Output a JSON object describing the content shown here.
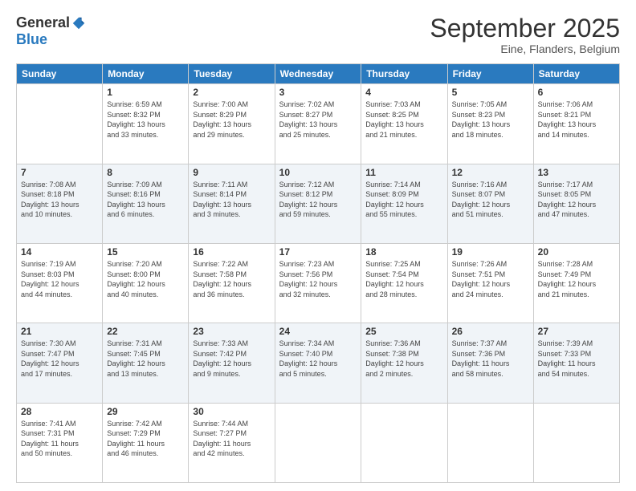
{
  "header": {
    "logo_general": "General",
    "logo_blue": "Blue",
    "month_title": "September 2025",
    "location": "Eine, Flanders, Belgium"
  },
  "days_of_week": [
    "Sunday",
    "Monday",
    "Tuesday",
    "Wednesday",
    "Thursday",
    "Friday",
    "Saturday"
  ],
  "weeks": [
    [
      {
        "day": "",
        "info": ""
      },
      {
        "day": "1",
        "info": "Sunrise: 6:59 AM\nSunset: 8:32 PM\nDaylight: 13 hours\nand 33 minutes."
      },
      {
        "day": "2",
        "info": "Sunrise: 7:00 AM\nSunset: 8:29 PM\nDaylight: 13 hours\nand 29 minutes."
      },
      {
        "day": "3",
        "info": "Sunrise: 7:02 AM\nSunset: 8:27 PM\nDaylight: 13 hours\nand 25 minutes."
      },
      {
        "day": "4",
        "info": "Sunrise: 7:03 AM\nSunset: 8:25 PM\nDaylight: 13 hours\nand 21 minutes."
      },
      {
        "day": "5",
        "info": "Sunrise: 7:05 AM\nSunset: 8:23 PM\nDaylight: 13 hours\nand 18 minutes."
      },
      {
        "day": "6",
        "info": "Sunrise: 7:06 AM\nSunset: 8:21 PM\nDaylight: 13 hours\nand 14 minutes."
      }
    ],
    [
      {
        "day": "7",
        "info": "Sunrise: 7:08 AM\nSunset: 8:18 PM\nDaylight: 13 hours\nand 10 minutes."
      },
      {
        "day": "8",
        "info": "Sunrise: 7:09 AM\nSunset: 8:16 PM\nDaylight: 13 hours\nand 6 minutes."
      },
      {
        "day": "9",
        "info": "Sunrise: 7:11 AM\nSunset: 8:14 PM\nDaylight: 13 hours\nand 3 minutes."
      },
      {
        "day": "10",
        "info": "Sunrise: 7:12 AM\nSunset: 8:12 PM\nDaylight: 12 hours\nand 59 minutes."
      },
      {
        "day": "11",
        "info": "Sunrise: 7:14 AM\nSunset: 8:09 PM\nDaylight: 12 hours\nand 55 minutes."
      },
      {
        "day": "12",
        "info": "Sunrise: 7:16 AM\nSunset: 8:07 PM\nDaylight: 12 hours\nand 51 minutes."
      },
      {
        "day": "13",
        "info": "Sunrise: 7:17 AM\nSunset: 8:05 PM\nDaylight: 12 hours\nand 47 minutes."
      }
    ],
    [
      {
        "day": "14",
        "info": "Sunrise: 7:19 AM\nSunset: 8:03 PM\nDaylight: 12 hours\nand 44 minutes."
      },
      {
        "day": "15",
        "info": "Sunrise: 7:20 AM\nSunset: 8:00 PM\nDaylight: 12 hours\nand 40 minutes."
      },
      {
        "day": "16",
        "info": "Sunrise: 7:22 AM\nSunset: 7:58 PM\nDaylight: 12 hours\nand 36 minutes."
      },
      {
        "day": "17",
        "info": "Sunrise: 7:23 AM\nSunset: 7:56 PM\nDaylight: 12 hours\nand 32 minutes."
      },
      {
        "day": "18",
        "info": "Sunrise: 7:25 AM\nSunset: 7:54 PM\nDaylight: 12 hours\nand 28 minutes."
      },
      {
        "day": "19",
        "info": "Sunrise: 7:26 AM\nSunset: 7:51 PM\nDaylight: 12 hours\nand 24 minutes."
      },
      {
        "day": "20",
        "info": "Sunrise: 7:28 AM\nSunset: 7:49 PM\nDaylight: 12 hours\nand 21 minutes."
      }
    ],
    [
      {
        "day": "21",
        "info": "Sunrise: 7:30 AM\nSunset: 7:47 PM\nDaylight: 12 hours\nand 17 minutes."
      },
      {
        "day": "22",
        "info": "Sunrise: 7:31 AM\nSunset: 7:45 PM\nDaylight: 12 hours\nand 13 minutes."
      },
      {
        "day": "23",
        "info": "Sunrise: 7:33 AM\nSunset: 7:42 PM\nDaylight: 12 hours\nand 9 minutes."
      },
      {
        "day": "24",
        "info": "Sunrise: 7:34 AM\nSunset: 7:40 PM\nDaylight: 12 hours\nand 5 minutes."
      },
      {
        "day": "25",
        "info": "Sunrise: 7:36 AM\nSunset: 7:38 PM\nDaylight: 12 hours\nand 2 minutes."
      },
      {
        "day": "26",
        "info": "Sunrise: 7:37 AM\nSunset: 7:36 PM\nDaylight: 11 hours\nand 58 minutes."
      },
      {
        "day": "27",
        "info": "Sunrise: 7:39 AM\nSunset: 7:33 PM\nDaylight: 11 hours\nand 54 minutes."
      }
    ],
    [
      {
        "day": "28",
        "info": "Sunrise: 7:41 AM\nSunset: 7:31 PM\nDaylight: 11 hours\nand 50 minutes."
      },
      {
        "day": "29",
        "info": "Sunrise: 7:42 AM\nSunset: 7:29 PM\nDaylight: 11 hours\nand 46 minutes."
      },
      {
        "day": "30",
        "info": "Sunrise: 7:44 AM\nSunset: 7:27 PM\nDaylight: 11 hours\nand 42 minutes."
      },
      {
        "day": "",
        "info": ""
      },
      {
        "day": "",
        "info": ""
      },
      {
        "day": "",
        "info": ""
      },
      {
        "day": "",
        "info": ""
      }
    ]
  ]
}
